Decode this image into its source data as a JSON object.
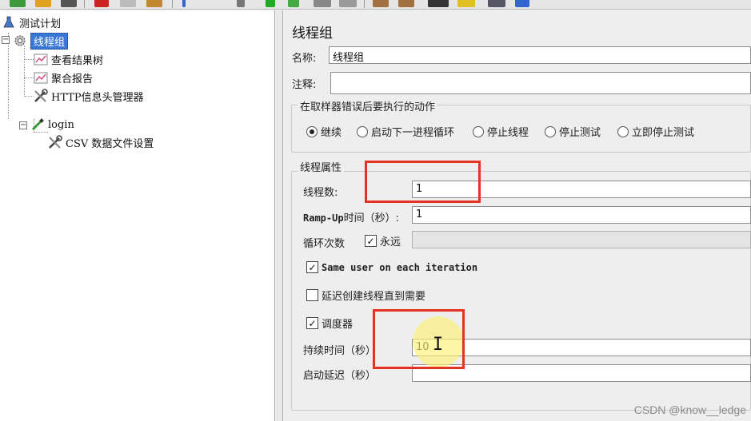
{
  "tree": {
    "root": "测试计划",
    "thread_group": "线程组",
    "result_tree": "查看结果树",
    "aggregate_report": "聚合报告",
    "http_header_manager": "HTTP信息头管理器",
    "login": "login",
    "csv_config": "CSV 数据文件设置"
  },
  "panel": {
    "title": "线程组",
    "name_label": "名称:",
    "name_value": "线程组",
    "comment_label": "注释:",
    "comment_value": "",
    "error_action_title": "在取样器错误后要执行的动作",
    "error_actions": [
      {
        "label": "继续",
        "selected": true
      },
      {
        "label": "启动下一进程循环",
        "selected": false
      },
      {
        "label": "停止线程",
        "selected": false
      },
      {
        "label": "停止测试",
        "selected": false
      },
      {
        "label": "立即停止测试",
        "selected": false
      }
    ],
    "thread_props_title": "线程属性",
    "threads_label": "线程数:",
    "threads_value": "1",
    "rampup_label_en": "Ramp-Up",
    "rampup_label_cn": "时间（秒）:",
    "rampup_value": "1",
    "loop_label": "循环次数",
    "forever_label": "永远",
    "forever_checked": true,
    "loop_value": "",
    "same_user_label": "Same user on each iteration",
    "same_user_checked": true,
    "delay_label": "延迟创建线程直到需要",
    "delay_checked": false,
    "scheduler_label": "调度器",
    "scheduler_checked": true,
    "duration_label": "持续时间（秒）",
    "duration_value": "10",
    "startup_delay_label": "启动延迟（秒）",
    "startup_delay_value": ""
  },
  "watermark": "CSDN @know__ledge",
  "colors": {
    "selection": "#3a78d8",
    "annotation_red": "#e53323",
    "cursor_highlight": "#fff078"
  }
}
